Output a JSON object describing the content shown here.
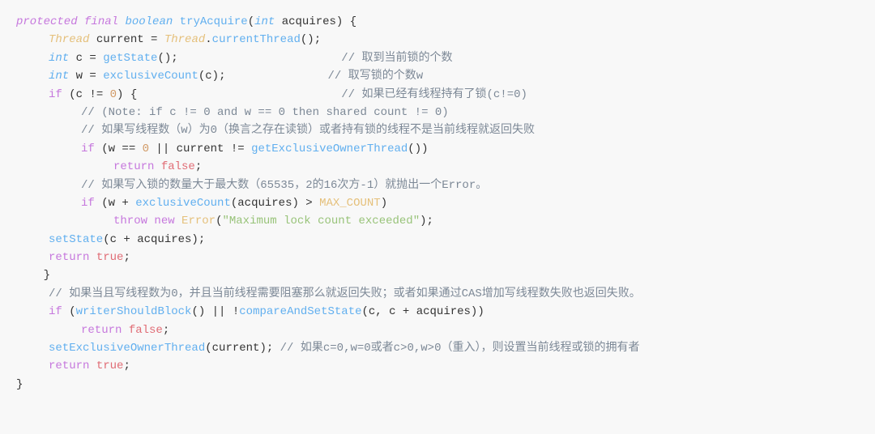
{
  "code": {
    "language": "java",
    "title": "tryAcquire method",
    "lines": [
      "protected final boolean tryAcquire(int acquires) {",
      "    Thread current = Thread.currentThread();",
      "    int c = getState();                        // 取到当前锁的个数",
      "    int w = exclusiveCount(c);               // 取写锁的个数w",
      "    if (c != 0) {                              // 如果已经有线程持有了锁(c!=0)",
      "        // (Note: if c != 0 and w == 0 then shared count != 0)",
      "",
      "        // 如果写线程数（w）为0（换言之存在读锁）或者持有锁的线程不是当前线程就返回失败",
      "        if (w == 0 || current != getExclusiveOwnerThread())",
      "            return false;",
      "        // 如果写入锁的数量大于最大数（65535，2的16次方-1）就抛出一个Error。",
      "        if (w + exclusiveCount(acquires) > MAX_COUNT)",
      "            throw new Error(\"Maximum lock count exceeded\");",
      "        setState(c + acquires);",
      "        return true;",
      "    }",
      "",
      "    // 如果当且写线程数为0，并且当前线程需要阻塞那么就返回失败；或者如果通过CAS增加写线程数失败也返回失败。",
      "    if (writerShouldBlock() || !compareAndSetState(c, c + acquires))",
      "        return false;",
      "",
      "    setExclusiveOwnerThread(current); // 如果c=0,w=0或者c>0,w>0（重入），则设置当前线程或锁的拥有者",
      "    return true;",
      "}"
    ]
  }
}
